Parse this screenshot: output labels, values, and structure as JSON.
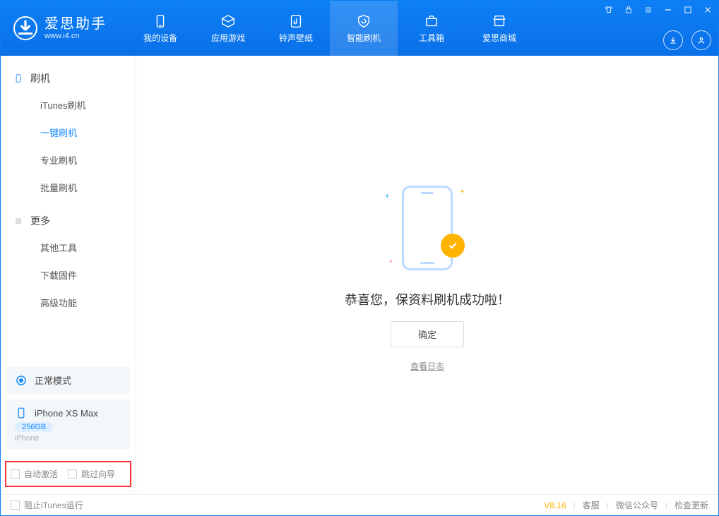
{
  "app": {
    "title": "爱思助手",
    "subtitle": "www.i4.cn"
  },
  "nav": {
    "my_device": "我的设备",
    "apps_games": "应用游戏",
    "ringtone_wallpaper": "铃声壁纸",
    "smart_flash": "智能刷机",
    "toolbox": "工具箱",
    "store": "爱思商城"
  },
  "sidebar": {
    "group_flash": "刷机",
    "items_flash": {
      "itunes_flash": "iTunes刷机",
      "one_key_flash": "一键刷机",
      "pro_flash": "专业刷机",
      "batch_flash": "批量刷机"
    },
    "group_more": "更多",
    "items_more": {
      "other_tools": "其他工具",
      "download_firmware": "下载固件",
      "advanced": "高级功能"
    }
  },
  "device_mode": {
    "label": "正常模式"
  },
  "device_info": {
    "name": "iPhone XS Max",
    "capacity": "256GB",
    "type": "iPhone"
  },
  "options": {
    "auto_activate": "自动激活",
    "skip_guide": "跳过向导"
  },
  "result": {
    "message": "恭喜您，保资料刷机成功啦！",
    "ok": "确定",
    "view_log": "查看日志"
  },
  "statusbar": {
    "block_itunes": "阻止iTunes运行",
    "version": "V8.16",
    "support": "客服",
    "wechat": "微信公众号",
    "check_update": "检查更新"
  }
}
